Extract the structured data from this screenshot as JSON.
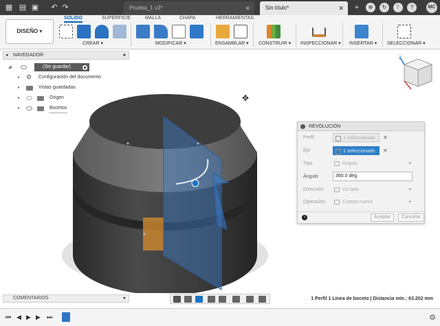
{
  "tabs": [
    {
      "label": "Prueba_1 v3*",
      "active": false
    },
    {
      "label": "Sin título*",
      "active": true
    }
  ],
  "user_initials": "MC",
  "ribbon": {
    "workspace": "DISEÑO",
    "tabs": [
      "SOLIDO",
      "SUPERFICIE",
      "MALLA",
      "CHAPA",
      "HERRAMIENTAS"
    ],
    "active_tab": "SOLIDO",
    "groups": [
      "CREAR",
      "MODIFICAR",
      "ENSAMBLAR",
      "CONSTRUIR",
      "INSPECCIONAR",
      "INSERTAR",
      "SELECCIONAR"
    ]
  },
  "navigator": {
    "title": "NAVEGADOR",
    "root": "(Sin guardar)",
    "items": [
      "Configuración del documento",
      "Vistas guardadas",
      "Origen",
      "Bocetos"
    ]
  },
  "dialog": {
    "title": "REVOLUCIÓN",
    "profile_label": "Perfil",
    "profile_value": "1 seleccionado",
    "axis_label": "Eje",
    "axis_value": "1 seleccionado",
    "type_label": "Tipo",
    "type_value": "Ángulo",
    "angle_label": "Ángulo",
    "angle_value": "360.0 deg",
    "direction_label": "Dirección",
    "direction_value": "Un lado",
    "operation_label": "Operación",
    "operation_value": "Cuerpo nuevo",
    "accept": "Aceptar",
    "cancel": "Cancelar"
  },
  "comments_label": "COMENTARIOS",
  "status_text": "1 Perfil 1 Línea de boceto | Distancia mín.: 63.202 mm",
  "colors": {
    "accent": "#1b74c4",
    "body_dark": "#3b3b3b",
    "profile_blue": "#3d7cc9"
  }
}
